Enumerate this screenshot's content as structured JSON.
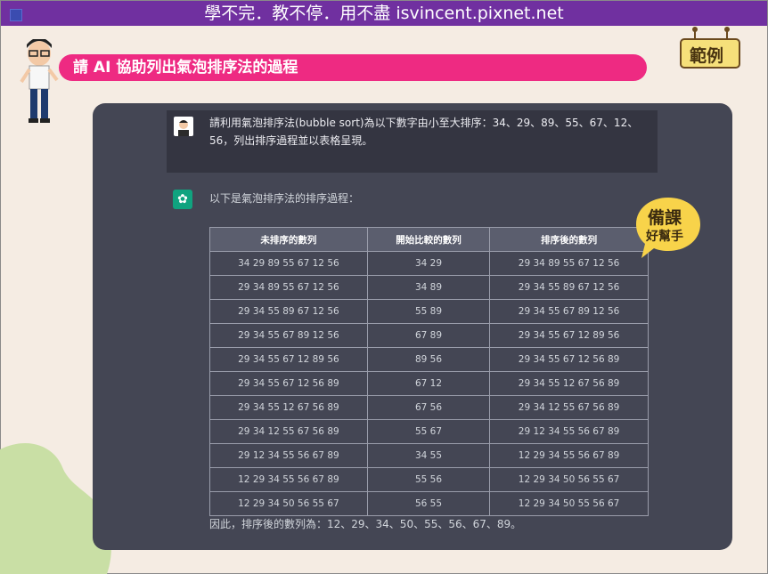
{
  "header": {
    "banner": "學不完．教不停．用不盡 isvincent.pixnet.net"
  },
  "slide": {
    "title": "請 AI 協助列出氣泡排序法的過程",
    "sign_label": "範例"
  },
  "badge": {
    "line1": "備課",
    "line2": "好幫手"
  },
  "chat": {
    "prompt": "請利用氣泡排序法(bubble sort)為以下數字由小至大排序：34、29、89、55、67、12、56，列出排序過程並以表格呈現。",
    "response_intro": "以下是氣泡排序法的排序過程：",
    "table": {
      "headers": [
        "未排序的數列",
        "開始比較的數列",
        "排序後的數列"
      ],
      "rows": [
        [
          "34 29 89 55 67 12 56",
          "34 29",
          "29 34 89 55 67 12 56"
        ],
        [
          "29 34 89 55 67 12 56",
          "34 89",
          "29 34 55 89 67 12 56"
        ],
        [
          "29 34 55 89 67 12 56",
          "55 89",
          "29 34 55 67 89 12 56"
        ],
        [
          "29 34 55 67 89 12 56",
          "67 89",
          "29 34 55 67 12 89 56"
        ],
        [
          "29 34 55 67 12 89 56",
          "89 56",
          "29 34 55 67 12 56 89"
        ],
        [
          "29 34 55 67 12 56 89",
          "67 12",
          "29 34 55 12 67 56 89"
        ],
        [
          "29 34 55 12 67 56 89",
          "67 56",
          "29 34 12 55 67 56 89"
        ],
        [
          "29 34 12 55 67 56 89",
          "55 67",
          "29 12 34 55 56 67 89"
        ],
        [
          "29 12 34 55 56 67 89",
          "34 55",
          "12 29 34 55 56 67 89"
        ],
        [
          "12 29 34 55 56 67 89",
          "55 56",
          "12 29 34 50 56 55 67"
        ],
        [
          "12 29 34 50 56 55 67",
          "56 55",
          "12 29 34 50 55 56 67"
        ]
      ]
    },
    "conclusion": "因此，排序後的數列為：12、29、34、50、55、56、67、89。"
  }
}
